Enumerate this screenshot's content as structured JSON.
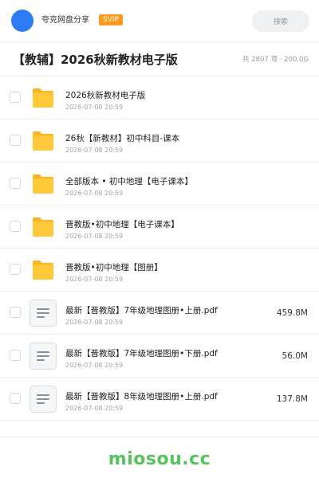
{
  "header": {
    "brand": "夸克网盘分享",
    "badge": "SVIP",
    "search_label": "搜索"
  },
  "title": {
    "text": "【教辅】2026秋新教材电子版",
    "meta": "共 2807 项 · 200.0G"
  },
  "files": [
    {
      "type": "folder",
      "name": "2026秋新教材电子版",
      "date": "2026-07-08 20:59",
      "size": ""
    },
    {
      "type": "folder",
      "name": "26秋【新教材】初中科目-课本",
      "date": "2026-07-08 20:59",
      "size": ""
    },
    {
      "type": "folder",
      "name": "全部版本 • 初中地理【电子课本】",
      "date": "2026-07-08 20:59",
      "size": ""
    },
    {
      "type": "folder",
      "name": "晋教版•初中地理【电子课本】",
      "date": "2026-07-08 20:59",
      "size": ""
    },
    {
      "type": "folder",
      "name": "晋教版•初中地理【图册】",
      "date": "2026-07-08 20:59",
      "size": ""
    },
    {
      "type": "file",
      "name": "最新【晋教版】7年级地理图册•上册.pdf",
      "date": "2026-07-08 20:59",
      "size": "459.8M"
    },
    {
      "type": "file",
      "name": "最新【晋教版】7年级地理图册•下册.pdf",
      "date": "2026-07-08 20:59",
      "size": "56.0M"
    },
    {
      "type": "file",
      "name": "最新【晋教版】8年级地理图册•上册.pdf",
      "date": "2026-07-08 20:59",
      "size": "137.8M"
    }
  ],
  "footer": {
    "logo": "miosou.cc"
  },
  "colors": {
    "accent": "#2d7cf6",
    "badge": "#ff9a1f",
    "folder": "#ffc93a",
    "logo": "#57c45b"
  },
  "icons": {
    "folder": "folder-icon",
    "document": "document-icon"
  }
}
